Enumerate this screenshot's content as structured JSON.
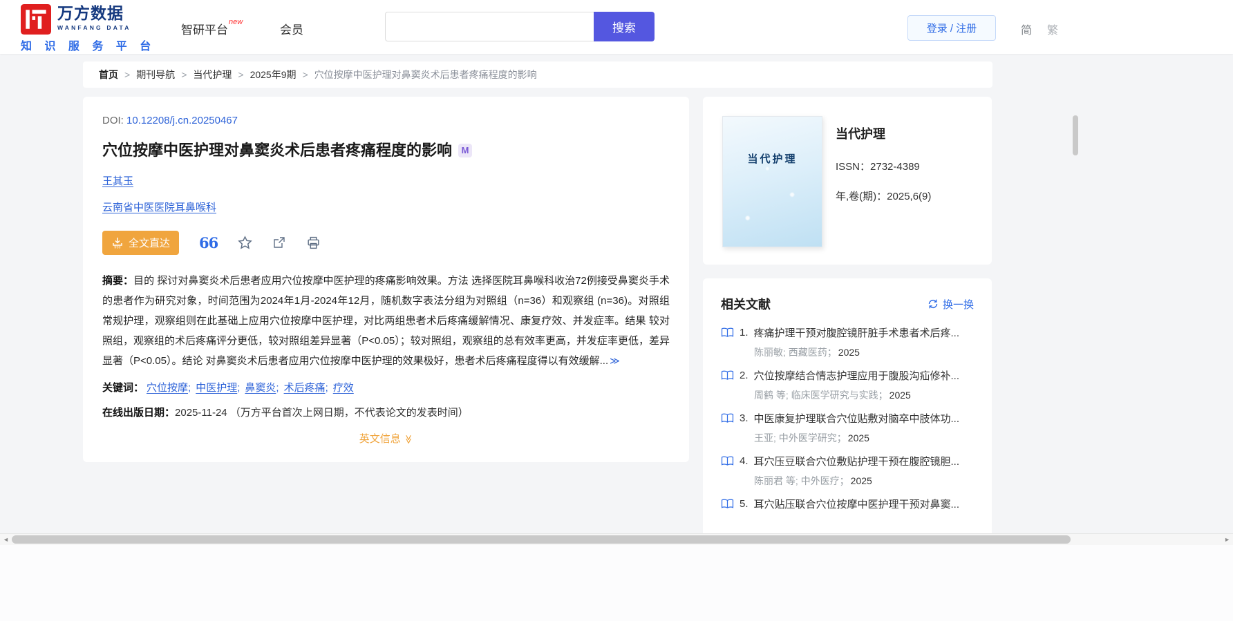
{
  "colors": {
    "logo_red": "#e01f1f",
    "brand_navy": "#15397f",
    "brand_blue": "#2e6be6",
    "link_blue": "#2e63d8",
    "search_purple": "#5457e0",
    "accent_orange": "#f0a53e"
  },
  "header": {
    "logo": {
      "brand": "万方数据",
      "brand_en": "WANFANG DATA",
      "tagline": "知 识 服 务 平 台"
    },
    "nav": [
      {
        "label": "智研平台",
        "badge": "new"
      },
      {
        "label": "会员",
        "badge": ""
      }
    ],
    "search": {
      "value": "",
      "button": "搜索"
    },
    "login_label": "登录 / 注册",
    "lang_simplified": "简",
    "lang_traditional": "繁"
  },
  "breadcrumb": {
    "items": [
      {
        "label": "首页",
        "sep": ">"
      },
      {
        "label": "期刊导航",
        "sep": ">"
      },
      {
        "label": "当代护理",
        "sep": ">"
      },
      {
        "label": "2025年9期",
        "sep": ">"
      },
      {
        "label": "穴位按摩中医护理对鼻窦炎术后患者疼痛程度的影响",
        "sep": ""
      }
    ]
  },
  "article": {
    "doi_label": "DOI: ",
    "doi": "10.12208/j.cn.20250467",
    "title": "穴位按摩中医护理对鼻窦炎术后患者疼痛程度的影响",
    "badge": "M",
    "author": "王其玉",
    "affiliation": "云南省中医医院耳鼻喉科",
    "fulltext_button": "全文直达",
    "quote_icon_text": "66",
    "abstract_label": "摘要：",
    "abstract": "目的 探讨对鼻窦炎术后患者应用穴位按摩中医护理的疼痛影响效果。方法 选择医院耳鼻喉科收治72例接受鼻窦炎手术的患者作为研究对象，时间范围为2024年1月-2024年12月，随机数字表法分组为对照组（n=36）和观察组 (n=36)。对照组常规护理，观察组则在此基础上应用穴位按摩中医护理，对比两组患者术后疼痛缓解情况、康复疗效、并发症率。结果 较对照组，观察组的术后疼痛评分更低，较对照组差异显著（P<0.05）；较对照组，观察组的总有效率更高，并发症率更低，差异显著（P<0.05）。结论 对鼻窦炎术后患者应用穴位按摩中医护理的效果极好，患者术后疼痛程度得以有效缓解...",
    "expand_icon": "≫",
    "keywords_label": "关键词：",
    "keywords": [
      {
        "label": "穴位按摩",
        "sep": ";"
      },
      {
        "label": "中医护理",
        "sep": ";"
      },
      {
        "label": "鼻窦炎",
        "sep": ";"
      },
      {
        "label": "术后疼痛",
        "sep": ";"
      },
      {
        "label": "疗效",
        "sep": ""
      }
    ],
    "pubdate_label": "在线出版日期：",
    "pubdate": "2025-11-24",
    "pubdate_note": " （万方平台首次上网日期，不代表论文的发表时间）",
    "english_info": "英文信息",
    "english_chevron": "≫"
  },
  "journal": {
    "cover_text": "当代护理",
    "name": "当代护理",
    "issn_label": "ISSN：",
    "issn": "2732-4389",
    "volume_label": "年,卷(期)：",
    "volume": "2025,6(9)"
  },
  "related": {
    "title": "相关文献",
    "refresh_label": "换一换",
    "items": [
      {
        "num": "1.",
        "title": "疼痛护理干预对腹腔镜肝脏手术患者术后疼...",
        "authors": "陈丽敏;",
        "journal": "西藏医药；",
        "year": "2025"
      },
      {
        "num": "2.",
        "title": "穴位按摩结合情志护理应用于腹股沟疝修补...",
        "authors": "周鹤 等;",
        "journal": "临床医学研究与实践；",
        "year": "2025"
      },
      {
        "num": "3.",
        "title": "中医康复护理联合穴位贴敷对脑卒中肢体功...",
        "authors": "王亚;",
        "journal": "中外医学研究；",
        "year": "2025"
      },
      {
        "num": "4.",
        "title": "耳穴压豆联合穴位敷贴护理干预在腹腔镜胆...",
        "authors": "陈丽君 等;",
        "journal": "中外医疗；",
        "year": "2025"
      },
      {
        "num": "5.",
        "title": "耳穴贴压联合穴位按摩中医护理干预对鼻窦...",
        "authors": "",
        "journal": "",
        "year": ""
      }
    ]
  },
  "scroll": {
    "left_arrow": "◄",
    "right_arrow": "►"
  }
}
